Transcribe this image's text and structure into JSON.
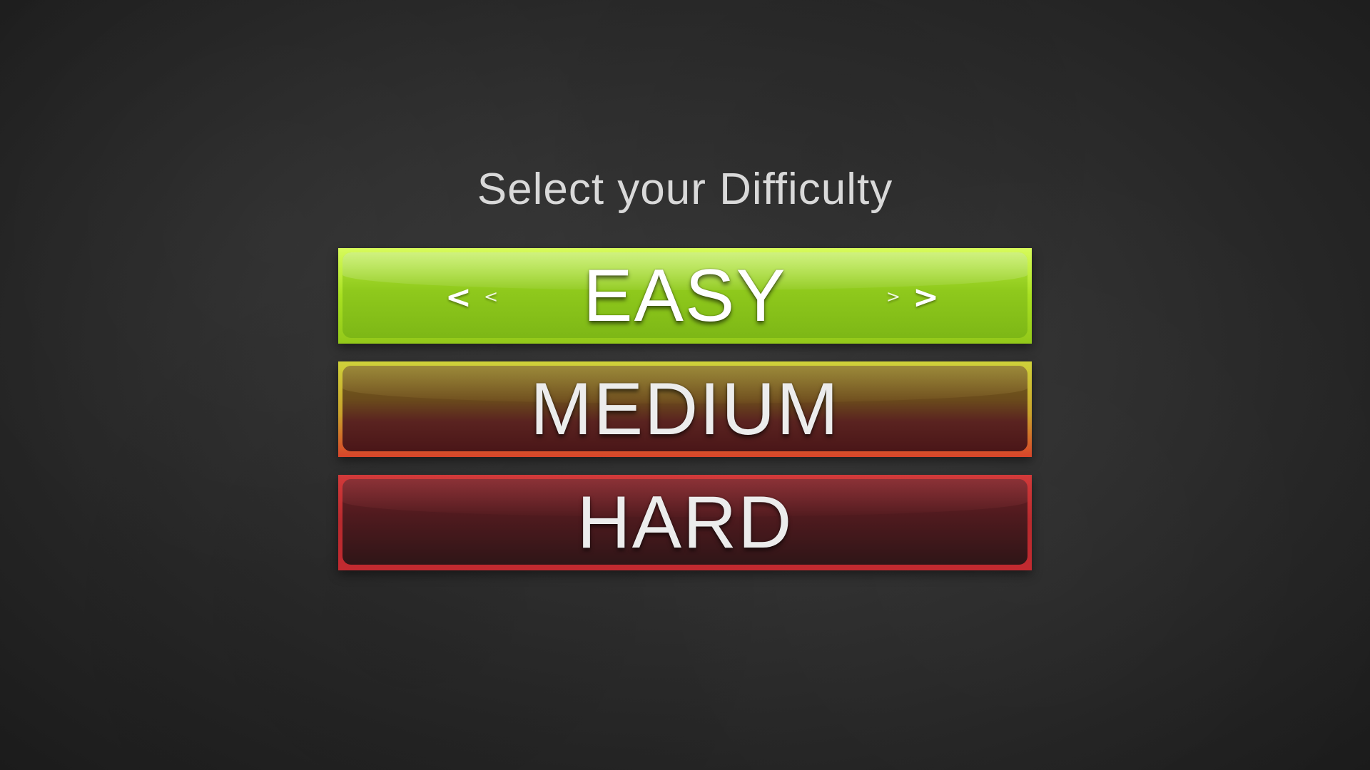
{
  "screen": {
    "title": "Select your Difficulty"
  },
  "difficulty": {
    "selected": "EASY",
    "options": [
      {
        "label": "EASY",
        "color": "#a8e021"
      },
      {
        "label": "MEDIUM",
        "color": "#c9a22b"
      },
      {
        "label": "HARD",
        "color": "#c22a30"
      }
    ],
    "arrows": {
      "left_big": "<",
      "left_small": "<",
      "right_small": ">",
      "right_big": ">"
    }
  }
}
